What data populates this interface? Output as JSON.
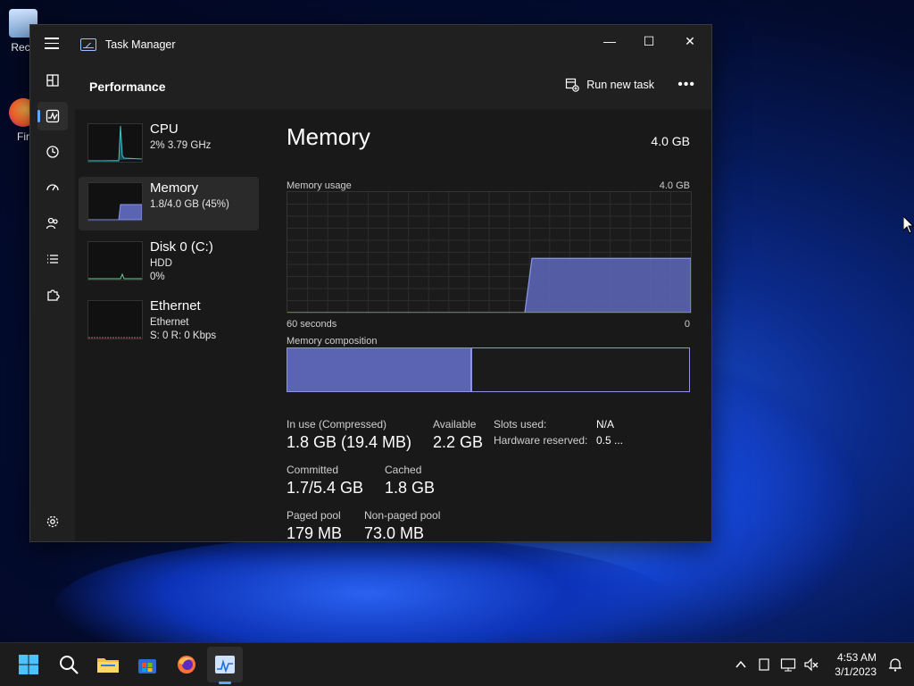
{
  "desktop": {
    "icons": [
      {
        "label": "Recy",
        "icon": "recycle-bin-icon"
      },
      {
        "label": "Fir",
        "icon": "firefox-icon"
      }
    ]
  },
  "window": {
    "title": "Task Manager",
    "controls": {
      "minimize": "—",
      "maximize": "☐",
      "close": "✕"
    }
  },
  "nav": {
    "items": [
      {
        "name": "processes",
        "icon": "processes-icon",
        "active": false
      },
      {
        "name": "performance",
        "icon": "performance-icon",
        "active": true
      },
      {
        "name": "app-history",
        "icon": "history-icon",
        "active": false
      },
      {
        "name": "startup-apps",
        "icon": "speedometer-icon",
        "active": false
      },
      {
        "name": "users",
        "icon": "users-icon",
        "active": false
      },
      {
        "name": "details",
        "icon": "list-icon",
        "active": false
      },
      {
        "name": "services",
        "icon": "puzzle-icon",
        "active": false
      }
    ],
    "settings_icon": "gear-icon"
  },
  "header": {
    "title": "Performance",
    "run_new_task": "Run new task",
    "more": "•••"
  },
  "resources": [
    {
      "name": "CPU",
      "line1": "2% 3.79 GHz",
      "line2": "",
      "selected": false,
      "accent": "#3ec5d1"
    },
    {
      "name": "Memory",
      "line1": "1.8/4.0 GB (45%)",
      "line2": "",
      "selected": true,
      "accent": "#8d96e6"
    },
    {
      "name": "Disk 0 (C:)",
      "line1": "HDD",
      "line2": "0%",
      "selected": false,
      "accent": "#6fcf97"
    },
    {
      "name": "Ethernet",
      "line1": "Ethernet",
      "line2": "S: 0 R: 0 Kbps",
      "selected": false,
      "accent": "#d46a7a"
    }
  ],
  "memory": {
    "title": "Memory",
    "total": "4.0 GB",
    "usage_label": "Memory usage",
    "usage_max": "4.0 GB",
    "x_left": "60 seconds",
    "x_right": "0",
    "composition_label": "Memory composition",
    "composition_in_use_fraction": 0.455,
    "usage_history_fraction": 0.45,
    "stats": {
      "in_use_label": "In use (Compressed)",
      "in_use_value": "1.8 GB (19.4 MB)",
      "available_label": "Available",
      "available_value": "2.2 GB",
      "committed_label": "Committed",
      "committed_value": "1.7/5.4 GB",
      "cached_label": "Cached",
      "cached_value": "1.8 GB",
      "paged_label": "Paged pool",
      "paged_value": "179 MB",
      "nonpaged_label": "Non-paged pool",
      "nonpaged_value": "73.0 MB",
      "slots_label": "Slots used:",
      "slots_value": "N/A",
      "hw_reserved_label": "Hardware reserved:",
      "hw_reserved_value": "0.5 ..."
    }
  },
  "taskbar": {
    "apps": [
      "start-icon",
      "search-icon",
      "file-explorer-icon",
      "store-icon",
      "firefox-icon",
      "task-manager-icon"
    ],
    "tray": [
      "chevron-up-icon",
      "tablet-icon",
      "network-icon",
      "volume-muted-icon"
    ],
    "time": "4:53 AM",
    "date": "3/1/2023",
    "notification_icon": "notification-icon"
  },
  "colors": {
    "accent": "#60a8ff",
    "memory_fill": "#5b64b3",
    "memory_line": "#8d96e6",
    "window_bg": "#202020"
  }
}
